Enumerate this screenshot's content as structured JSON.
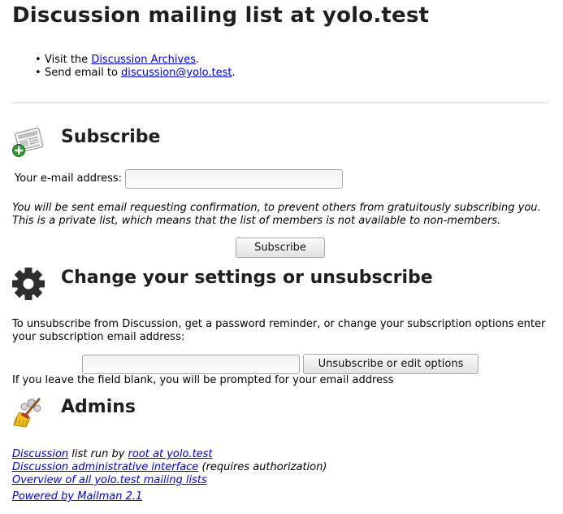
{
  "page": {
    "title": "Discussion mailing list at yolo.test",
    "links": [
      {
        "prefix": "Visit the ",
        "link": "Discussion Archives",
        "suffix": "."
      },
      {
        "prefix": "Send email to ",
        "link": "discussion@yolo.test",
        "suffix": "."
      }
    ]
  },
  "subscribe": {
    "heading": "Subscribe",
    "icon": "subscribe-add-icon",
    "email_label": "Your e-mail address:",
    "email_value": "",
    "note_line1": "You will be sent email requesting confirmation, to prevent others from gratuitously subscribing you.",
    "note_line2": "This is a private list, which means that the list of members is not available to non-members.",
    "button_label": "Subscribe"
  },
  "settings": {
    "heading": "Change your settings or unsubscribe",
    "icon": "gear-icon",
    "desc_line1": "To unsubscribe from Discussion, get a password reminder, or change your subscription options enter",
    "desc_line2": "your subscription email address:",
    "email_value": "",
    "button_label": "Unsubscribe or edit options",
    "hint": "If you leave the field blank, you will be prompted for your email address"
  },
  "admins": {
    "heading": "Admins",
    "icon": "broom-icon",
    "line1_link1": "Discussion",
    "line1_text": " list run by ",
    "line1_link2": "root at yolo.test",
    "line2_link": "Discussion administrative interface",
    "line2_text": " (requires authorization)",
    "line3_link": "Overview of all yolo.test mailing lists",
    "line4_link": "Powered by Mailman 2.1"
  },
  "colors": {
    "link": "#0000ee",
    "heading": "#1f1f1f",
    "rule": "#d0d0d0"
  }
}
